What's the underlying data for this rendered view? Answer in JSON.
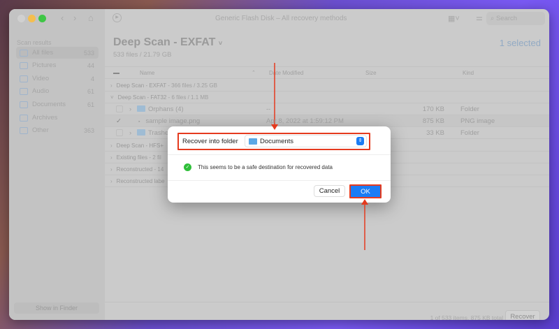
{
  "window": {
    "title": "Generic Flash Disk – All recovery methods",
    "search_placeholder": "Search"
  },
  "sidebar": {
    "heading": "Scan results",
    "items": [
      {
        "label": "All files",
        "count": "533"
      },
      {
        "label": "Pictures",
        "count": "44"
      },
      {
        "label": "Video",
        "count": "4"
      },
      {
        "label": "Audio",
        "count": "61"
      },
      {
        "label": "Documents",
        "count": "61"
      },
      {
        "label": "Archives",
        "count": ""
      },
      {
        "label": "Other",
        "count": "363"
      }
    ],
    "show_in_finder": "Show in Finder"
  },
  "header": {
    "title": "Deep Scan - EXFAT",
    "subtitle": "533 files / 21.79 GB",
    "selected": "1 selected"
  },
  "columns": {
    "name": "Name",
    "date": "Date Modified",
    "size": "Size",
    "kind": "Kind"
  },
  "groups": [
    {
      "name": "Deep Scan - EXFAT -",
      "info": "366 files / 3.25 GB"
    },
    {
      "name": "Deep Scan - FAT32 -",
      "info": "6 files / 1.1 MB"
    },
    {
      "name": "Deep Scan - HFS+",
      "info": ""
    },
    {
      "name": "Existing files -",
      "info": "2 fil"
    },
    {
      "name": "Reconstructed -",
      "info": "14"
    },
    {
      "name": "Reconstructed labe",
      "info": ""
    }
  ],
  "files": [
    {
      "name": "Orphans (4)",
      "date": "--",
      "size": "170 KB",
      "kind": "Folder"
    },
    {
      "name": "sample image.png",
      "date": "Apr 8, 2022 at 1:59:12 PM",
      "size": "875 KB",
      "kind": "PNG image"
    },
    {
      "name": "Trashe",
      "date": "",
      "size": "33 KB",
      "kind": "Folder"
    }
  ],
  "footer": {
    "status": "1 of 533 items, 875 KB total",
    "recover": "Recover"
  },
  "dialog": {
    "label": "Recover into folder",
    "folder": "Documents",
    "message": "This seems to be a safe destination for recovered data",
    "cancel": "Cancel",
    "ok": "OK"
  },
  "colors": {
    "accent": "#1a7cf5",
    "highlight": "#e53a1e",
    "success": "#2fbf3a"
  }
}
